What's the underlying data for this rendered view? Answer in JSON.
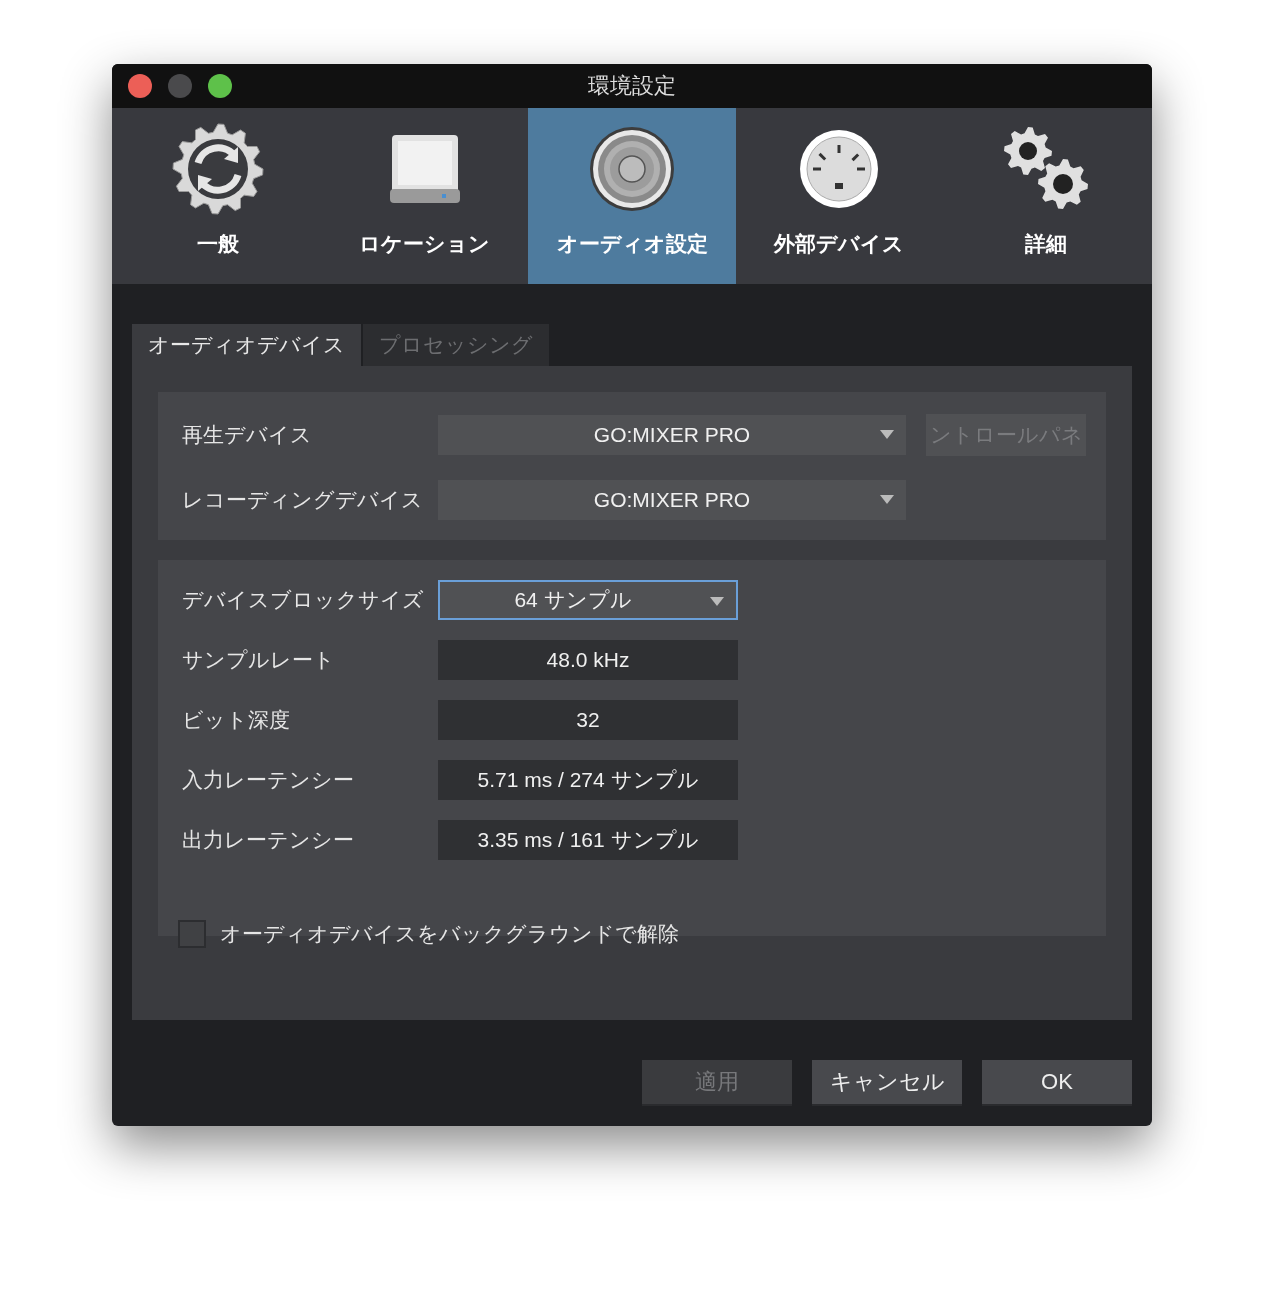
{
  "window": {
    "title": "環境設定"
  },
  "toolbar": [
    {
      "label": "一般",
      "kind": "sync-gear",
      "selected": false
    },
    {
      "label": "ロケーション",
      "kind": "drive",
      "selected": false
    },
    {
      "label": "オーディオ設定",
      "kind": "speaker",
      "selected": true
    },
    {
      "label": "外部デバイス",
      "kind": "port",
      "selected": false
    },
    {
      "label": "詳細",
      "kind": "gears",
      "selected": false
    }
  ],
  "sub_tabs": [
    {
      "label": "オーディオデバイス",
      "selected": true
    },
    {
      "label": "プロセッシング",
      "selected": false
    }
  ],
  "device_settings": [
    {
      "label": "再生デバイス",
      "value": "GO:MIXER PRO",
      "kind": "dropdown"
    },
    {
      "label": "レコーディングデバイス",
      "value": "GO:MIXER PRO",
      "kind": "dropdown"
    }
  ],
  "control_panel_button": {
    "label": "ントロールパネ",
    "disabled": true
  },
  "audio_settings": [
    {
      "label": "デバイスブロックサイズ",
      "value": "64 サンプル",
      "kind": "dropdown",
      "focused": true
    },
    {
      "label": "サンプルレート",
      "value": "48.0 kHz",
      "kind": "readout",
      "focused": false
    },
    {
      "label": "ビット深度",
      "value": "32",
      "kind": "readout",
      "focused": false
    },
    {
      "label": "入力レーテンシー",
      "value": "5.71 ms / 274 サンプル",
      "kind": "readout",
      "focused": false
    },
    {
      "label": "出力レーテンシー",
      "value": "3.35 ms / 161 サンプル",
      "kind": "readout",
      "focused": false
    }
  ],
  "background_release": {
    "label": "オーディオデバイスをバックグラウンドで解除",
    "checked": false
  },
  "buttons": [
    {
      "label": "適用",
      "disabled": true
    },
    {
      "label": "キャンセル",
      "disabled": false
    },
    {
      "label": "OK",
      "disabled": false
    }
  ]
}
